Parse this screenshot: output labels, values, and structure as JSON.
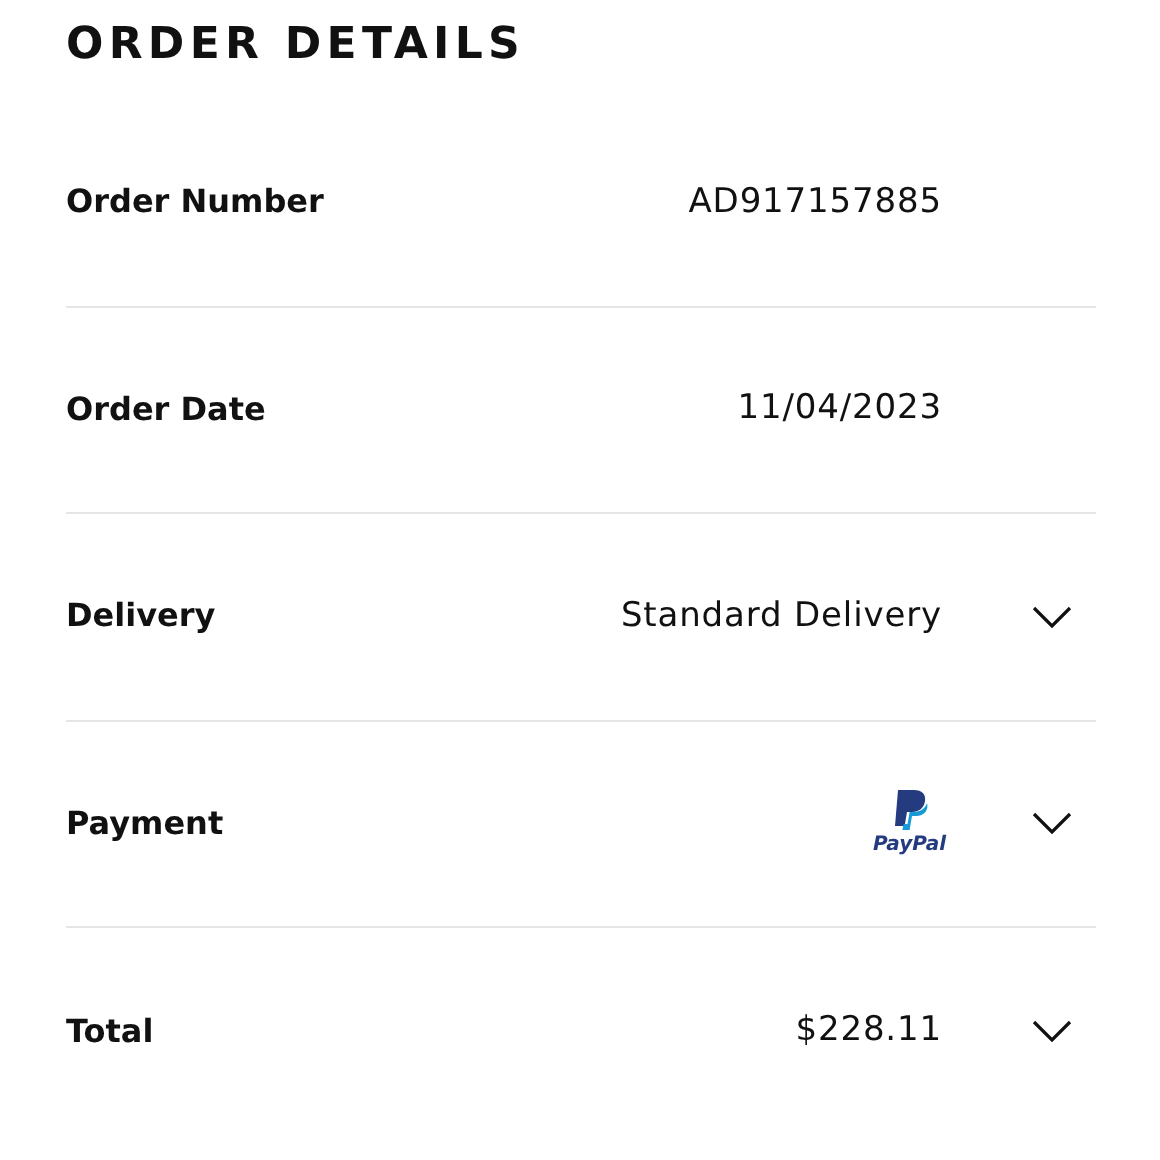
{
  "title": "ORDER DETAILS",
  "rows": [
    {
      "label": "Order Number",
      "kind": "text",
      "value": "AD917157885",
      "expandable": false
    },
    {
      "label": "Order Date",
      "kind": "text",
      "value": "11/04/2023",
      "expandable": false
    },
    {
      "label": "Delivery",
      "kind": "text",
      "value": "Standard Delivery",
      "expandable": true
    },
    {
      "label": "Payment",
      "kind": "paypal",
      "value": "PayPal",
      "expandable": true
    },
    {
      "label": "Total",
      "kind": "text",
      "value": "$228.11",
      "expandable": true
    }
  ]
}
